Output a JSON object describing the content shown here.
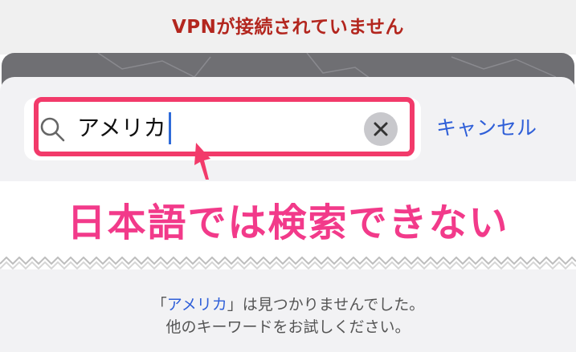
{
  "vpn_status": "VPNが接続されていません",
  "search": {
    "value": "アメリカ",
    "cancel_label": "キャンセル"
  },
  "annotation": "日本語では検索できない",
  "result": {
    "open_quote": "「",
    "keyword": "アメリカ",
    "message_tail": "」は見つかりませんでした。",
    "line2": "他のキーワードをお試しください。"
  },
  "colors": {
    "status_red": "#b3261e",
    "accent_blue": "#2f5fd8",
    "highlight_pink": "#f23a6a",
    "annotation_pink": "#f23a8a"
  },
  "icons": {
    "search": "search-icon",
    "clear": "clear-icon",
    "pointer": "pointer-arrow-icon"
  }
}
